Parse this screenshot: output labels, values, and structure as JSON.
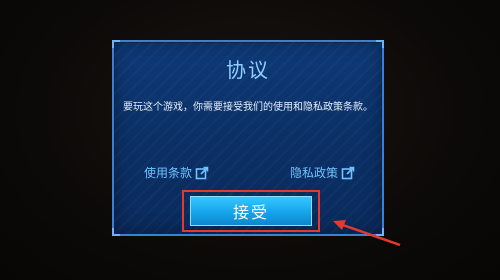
{
  "dialog": {
    "title": "协议",
    "message": "要玩这个游戏，你需要接受我们的使用和隐私政策条款。",
    "links": {
      "terms_label": "使用条款",
      "privacy_label": "隐私政策"
    },
    "accept_label": "接受"
  },
  "colors": {
    "panel": "#0b3168",
    "border": "#3d7fd0",
    "title": "#8fd0ff",
    "link": "#6fc2ff",
    "button": "#16a4ea",
    "highlight": "#e23a2c"
  },
  "icons": {
    "link_icon": "external-link-icon"
  }
}
